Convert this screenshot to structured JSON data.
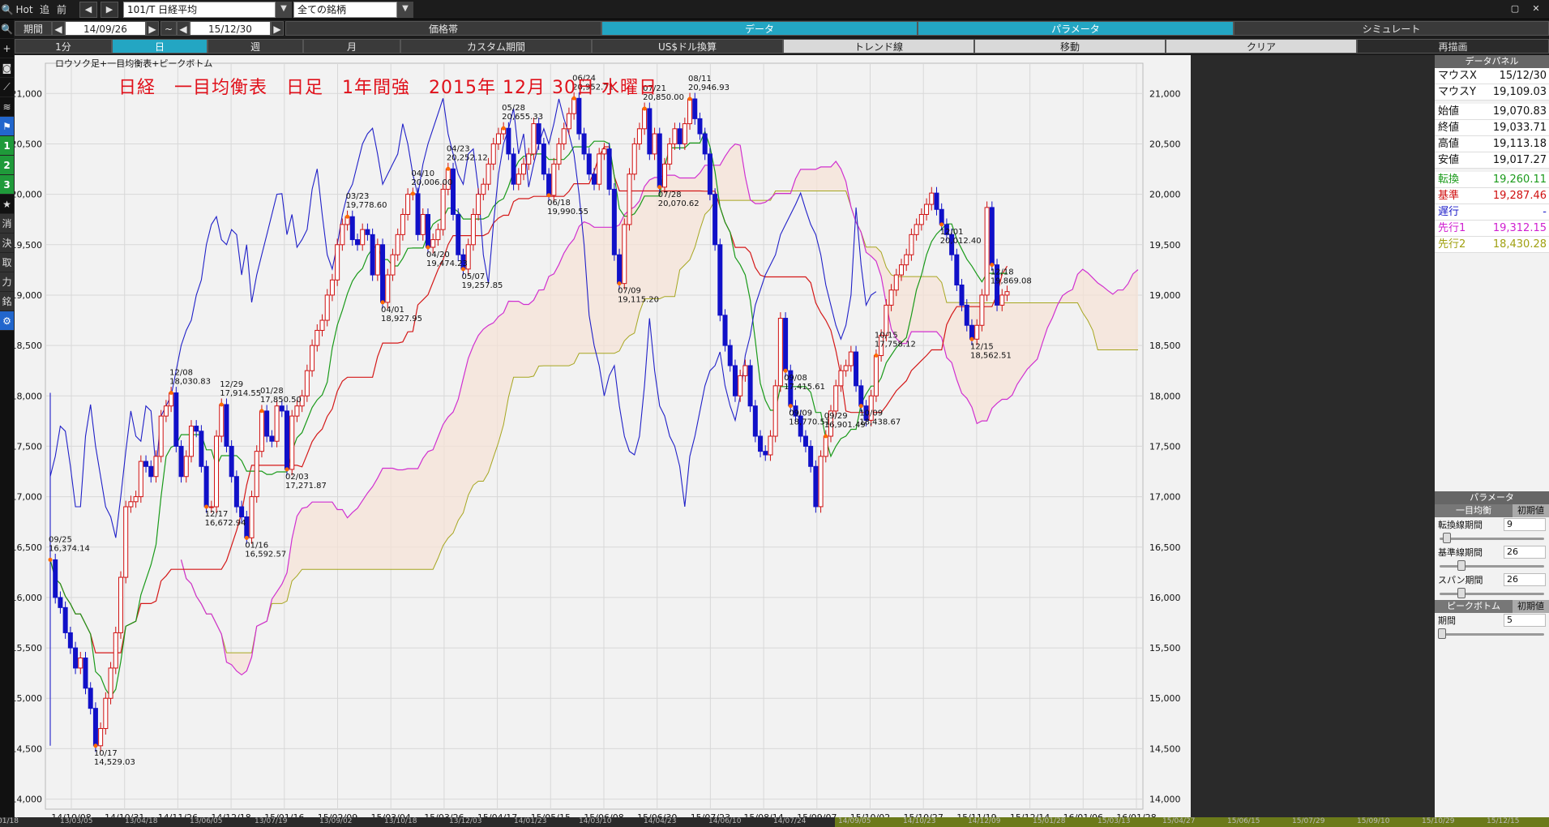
{
  "toolbar": {
    "hot": "Hot",
    "add": "追",
    "prev": "前",
    "symbol": "101/T 日経平均",
    "universe": "全ての銘柄",
    "period_label": "期間",
    "date_from": "14/09/26",
    "tilde": "~",
    "date_to": "15/12/30",
    "tabs": [
      "価格帯",
      "データ",
      "パラメータ",
      "シミュレート"
    ],
    "timeframes": [
      "1分",
      "日",
      "週",
      "月",
      "カスタム期間",
      "US$ドル換算",
      "トレンド線",
      "移動",
      "クリア",
      "再描画"
    ]
  },
  "left_tools": [
    {
      "icon": "search-icon",
      "glyph": "🔍"
    },
    {
      "icon": "plus-icon",
      "glyph": "+"
    },
    {
      "icon": "camera-icon",
      "glyph": "◙"
    },
    {
      "icon": "trendline-icon",
      "glyph": "⟋"
    },
    {
      "icon": "channel-icon",
      "glyph": "≋"
    },
    {
      "icon": "flag-icon",
      "glyph": "⚑"
    },
    {
      "icon": "one-icon",
      "glyph": "1"
    },
    {
      "icon": "two-icon",
      "glyph": "2"
    },
    {
      "icon": "three-icon",
      "glyph": "3"
    },
    {
      "icon": "star-icon",
      "glyph": "★"
    },
    {
      "icon": "erase-icon",
      "glyph": "消"
    },
    {
      "icon": "settle-icon",
      "glyph": "決"
    },
    {
      "icon": "take-icon",
      "glyph": "取"
    },
    {
      "icon": "power-icon",
      "glyph": "力"
    },
    {
      "icon": "brand-icon",
      "glyph": "銘"
    },
    {
      "icon": "gear-icon",
      "glyph": "⚙"
    }
  ],
  "chart": {
    "legend": "ロウソク足+一目均衡表+ピークボトム",
    "title": "日経　一目均衡表　日足　1年間強　2015年 12月 30日 水曜日"
  },
  "chart_data": {
    "type": "candlestick",
    "title": "日経　一目均衡表　日足　1年間強　2015年 12月 30日 水曜日",
    "ylim": [
      13900,
      21300
    ],
    "yticks": [
      14000,
      14500,
      15000,
      15500,
      16000,
      16500,
      17000,
      17500,
      18000,
      18500,
      19000,
      19500,
      20000,
      20500,
      21000
    ],
    "ytick_labels": [
      "14,000",
      "14,500",
      "15,000",
      "15,500",
      "16,000",
      "16,500",
      "17,000",
      "17,500",
      "18,000",
      "18,500",
      "19,000",
      "19,500",
      "20,000",
      "20,500",
      "21,000"
    ],
    "xticks": [
      "14/10/08",
      "14/10/31",
      "14/11/26",
      "14/12/18",
      "15/01/16",
      "15/02/09",
      "15/03/04",
      "15/03/26",
      "15/04/17",
      "15/05/15",
      "15/06/08",
      "15/06/30",
      "15/07/23",
      "15/08/14",
      "15/09/07",
      "15/10/02",
      "15/10/27",
      "15/11/19",
      "15/12/14",
      "16/01/06",
      "16/01/28"
    ],
    "close": [
      16374,
      16000,
      15900,
      15650,
      15500,
      15300,
      15400,
      15100,
      14900,
      14529,
      14700,
      15000,
      15300,
      15650,
      16200,
      16900,
      16950,
      17000,
      17350,
      17300,
      17200,
      17400,
      17800,
      17900,
      18030,
      17500,
      17200,
      17400,
      17700,
      17650,
      17300,
      16900,
      16900,
      17600,
      17914,
      17500,
      17200,
      16900,
      16800,
      16592,
      17000,
      17450,
      17850,
      17600,
      17550,
      17900,
      17850,
      17271,
      17800,
      17900,
      18000,
      18250,
      18500,
      18650,
      18750,
      19000,
      19150,
      19500,
      19700,
      19778,
      19550,
      19500,
      19650,
      19600,
      19200,
      19500,
      18928,
      19200,
      19400,
      19600,
      19800,
      20000,
      20006,
      19600,
      19800,
      19474,
      19550,
      19650,
      20050,
      20252,
      19800,
      19400,
      19258,
      19500,
      19800,
      20000,
      20100,
      20300,
      20500,
      20600,
      20655,
      20400,
      20100,
      20200,
      20300,
      20400,
      20700,
      20500,
      20200,
      19990,
      20300,
      20500,
      20650,
      20800,
      20952,
      20600,
      20400,
      20200,
      20100,
      20400,
      20450,
      20050,
      19400,
      19115,
      19700,
      20200,
      20500,
      20650,
      20850,
      20400,
      20600,
      20071,
      20300,
      20500,
      20650,
      20500,
      20700,
      20946,
      20750,
      20600,
      20400,
      20000,
      19500,
      18800,
      18500,
      18300,
      18000,
      18200,
      18300,
      17900,
      17600,
      17450,
      17415,
      17600,
      18100,
      18770,
      18250,
      17900,
      17800,
      17600,
      17500,
      17300,
      16901,
      17400,
      17600,
      17850,
      18100,
      18250,
      18300,
      18436,
      18100,
      17900,
      17758,
      18000,
      18400,
      18600,
      18900,
      19050,
      19200,
      19300,
      19400,
      19600,
      19700,
      19800,
      19900,
      20012,
      19850,
      19700,
      19600,
      19400,
      19100,
      18900,
      18700,
      18563,
      18700,
      19000,
      19869,
      19300,
      18900,
      19000,
      19034
    ],
    "tenkan_last": 19260.11,
    "kijun_last": 19287.46,
    "senkou1_last": 19312.15,
    "senkou2_last": 18430.28,
    "peaks": [
      {
        "date": "09/25",
        "value": "16,374.14"
      },
      {
        "date": "10/17",
        "value": "14,529.03"
      },
      {
        "date": "12/08",
        "value": "18,030.83"
      },
      {
        "date": "12/17",
        "value": "16,672.94"
      },
      {
        "date": "12/29",
        "value": "17,914.55"
      },
      {
        "date": "01/16",
        "value": "16,592.57"
      },
      {
        "date": "01/28",
        "value": "17,850.50"
      },
      {
        "date": "02/03",
        "value": "17,271.87"
      },
      {
        "date": "03/23",
        "value": "19,778.60"
      },
      {
        "date": "04/01",
        "value": "18,927.95"
      },
      {
        "date": "04/10",
        "value": "20,006.00"
      },
      {
        "date": "04/20",
        "value": "19,474.23"
      },
      {
        "date": "04/23",
        "value": "20,252.12"
      },
      {
        "date": "05/07",
        "value": "19,257.85"
      },
      {
        "date": "05/28",
        "value": "20,655.33"
      },
      {
        "date": "06/18",
        "value": "19,990.55"
      },
      {
        "date": "06/24",
        "value": "20,952.71"
      },
      {
        "date": "07/09",
        "value": "19,115.20"
      },
      {
        "date": "07/21",
        "value": "20,850.00"
      },
      {
        "date": "07/28",
        "value": "20,070.62"
      },
      {
        "date": "08/11",
        "value": "20,946.93"
      },
      {
        "date": "09/08",
        "value": "17,415.61"
      },
      {
        "date": "09/09",
        "value": "18,770.51"
      },
      {
        "date": "09/29",
        "value": "16,901.49"
      },
      {
        "date": "10/09",
        "value": "18,438.67"
      },
      {
        "date": "10/15",
        "value": "17,758.12"
      },
      {
        "date": "12/01",
        "value": "20,012.40"
      },
      {
        "date": "12/15",
        "value": "18,562.51"
      },
      {
        "date": "12/18",
        "value": "19,869.08"
      }
    ]
  },
  "data_panel": {
    "title": "データパネル",
    "rows": [
      {
        "label": "マウスX",
        "value": "15/12/30",
        "color": "#111111"
      },
      {
        "label": "マウスY",
        "value": "19,109.03",
        "color": "#111111"
      },
      {
        "label": "始値",
        "value": "19,070.83",
        "color": "#111111"
      },
      {
        "label": "終値",
        "value": "19,033.71",
        "color": "#111111"
      },
      {
        "label": "高値",
        "value": "19,113.18",
        "color": "#111111"
      },
      {
        "label": "安値",
        "value": "19,017.27",
        "color": "#111111"
      },
      {
        "label": "転換",
        "value": "19,260.11",
        "color": "#1a9a1a"
      },
      {
        "label": "基準",
        "value": "19,287.46",
        "color": "#d01010"
      },
      {
        "label": "遅行",
        "value": "-",
        "color": "#1a1ac8"
      },
      {
        "label": "先行1",
        "value": "19,312.15",
        "color": "#d020d0"
      },
      {
        "label": "先行2",
        "value": "18,430.28",
        "color": "#a0a010"
      }
    ]
  },
  "params_panel": {
    "title": "パラメータ",
    "ichimoku_tab": "一目均衡",
    "init_tab": "初期値",
    "tenkan_label": "転換線期間",
    "tenkan_value": "9",
    "tenkan_level": 0.05,
    "kijun_label": "基準線期間",
    "kijun_value": "26",
    "kijun_level": 0.2,
    "span_label": "スパン期間",
    "span_value": "26",
    "span_level": 0.2,
    "peak_tab": "ピークボトム",
    "period_label": "期間",
    "period_value": "5",
    "period_level": 0.0
  },
  "bottom_dates": [
    "/01/18",
    "13/03/05",
    "13/04/18",
    "13/06/05",
    "13/07/19",
    "13/09/02",
    "13/10/18",
    "13/12/03",
    "14/01/23",
    "14/03/10",
    "14/04/23",
    "14/06/10",
    "14/07/24",
    "14/09/05",
    "14/10/23",
    "14/12/09",
    "15/01/28",
    "15/03/13",
    "15/04/27",
    "15/06/15",
    "15/07/29",
    "15/09/10",
    "15/10/29",
    "15/12/15"
  ]
}
